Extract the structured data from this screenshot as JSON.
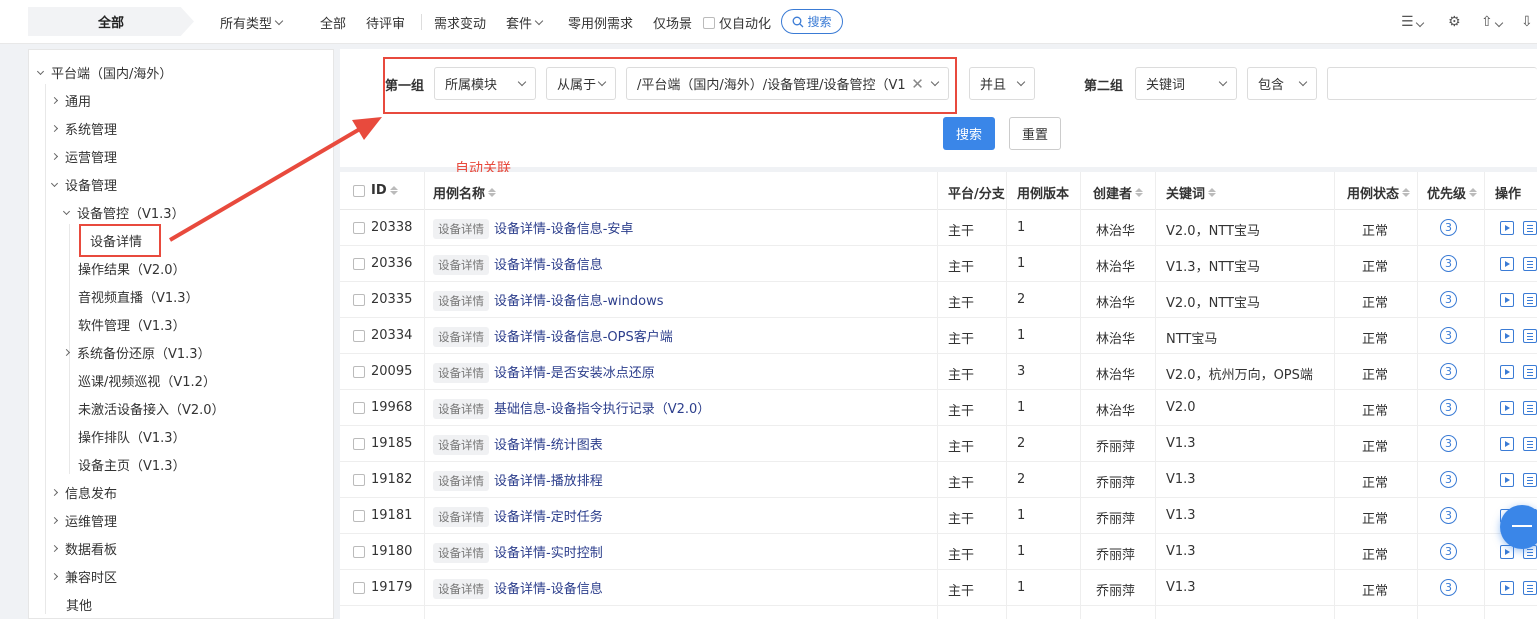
{
  "topbar": {
    "all_tab": "全部",
    "type_select": "所有类型",
    "items": [
      "全部",
      "待评审",
      "需求变动",
      "套件",
      "零用例需求",
      "仅场景"
    ],
    "auto_only_label": "仅自动化",
    "search_label": "搜索"
  },
  "tree": {
    "root": "平台端（国内/海外）",
    "nodes": [
      "通用",
      "系统管理",
      "运营管理",
      "设备管理",
      "设备管控（V1.3）",
      "设备详情",
      "操作结果（V2.0）",
      "音视频直播（V1.3）",
      "软件管理（V1.3）",
      "系统备份还原（V1.3）",
      "巡课/视频巡视（V1.2）",
      "未激活设备接入（V2.0）",
      "操作排队（V1.3）",
      "设备主页（V1.3）",
      "信息发布",
      "运维管理",
      "数据看板",
      "兼容时区",
      "其他"
    ]
  },
  "filter": {
    "group1_label": "第一组",
    "field1": "所属模块",
    "op1": "从属于",
    "value1": "/平台端（国内/海外）/设备管理/设备管控（V1",
    "logic": "并且",
    "group2_label": "第二组",
    "field2": "关键词",
    "op2": "包含",
    "search_button": "搜索",
    "reset_button": "重置",
    "annotation": "自动关联"
  },
  "table": {
    "headers": {
      "id": "ID",
      "name": "用例名称",
      "platform": "平台/分支",
      "version": "用例版本",
      "creator": "创建者",
      "keyword": "关键词",
      "status": "用例状态",
      "priority": "优先级",
      "action": "操作"
    },
    "tag": "设备详情",
    "rows": [
      {
        "id": "20338",
        "name": "设备详情-设备信息-安卓",
        "platform": "主干",
        "version": "1",
        "creator": "林治华",
        "keyword": "V2.0，NTT宝马",
        "status": "正常",
        "priority": "3"
      },
      {
        "id": "20336",
        "name": "设备详情-设备信息",
        "platform": "主干",
        "version": "1",
        "creator": "林治华",
        "keyword": "V1.3，NTT宝马",
        "status": "正常",
        "priority": "3"
      },
      {
        "id": "20335",
        "name": "设备详情-设备信息-windows",
        "platform": "主干",
        "version": "2",
        "creator": "林治华",
        "keyword": "V2.0，NTT宝马",
        "status": "正常",
        "priority": "3"
      },
      {
        "id": "20334",
        "name": "设备详情-设备信息-OPS客户端",
        "platform": "主干",
        "version": "1",
        "creator": "林治华",
        "keyword": "NTT宝马",
        "status": "正常",
        "priority": "3"
      },
      {
        "id": "20095",
        "name": "设备详情-是否安装冰点还原",
        "platform": "主干",
        "version": "3",
        "creator": "林治华",
        "keyword": "V2.0，杭州万向，OPS端",
        "status": "正常",
        "priority": "3"
      },
      {
        "id": "19968",
        "name": "基础信息-设备指令执行记录（V2.0）",
        "platform": "主干",
        "version": "1",
        "creator": "林治华",
        "keyword": "V2.0",
        "status": "正常",
        "priority": "3"
      },
      {
        "id": "19185",
        "name": "设备详情-统计图表",
        "platform": "主干",
        "version": "2",
        "creator": "乔丽萍",
        "keyword": "V1.3",
        "status": "正常",
        "priority": "3"
      },
      {
        "id": "19182",
        "name": "设备详情-播放排程",
        "platform": "主干",
        "version": "2",
        "creator": "乔丽萍",
        "keyword": "V1.3",
        "status": "正常",
        "priority": "3"
      },
      {
        "id": "19181",
        "name": "设备详情-定时任务",
        "platform": "主干",
        "version": "1",
        "creator": "乔丽萍",
        "keyword": "V1.3",
        "status": "正常",
        "priority": "3"
      },
      {
        "id": "19180",
        "name": "设备详情-实时控制",
        "platform": "主干",
        "version": "1",
        "creator": "乔丽萍",
        "keyword": "V1.3",
        "status": "正常",
        "priority": "3"
      },
      {
        "id": "19179",
        "name": "设备详情-设备信息",
        "platform": "主干",
        "version": "1",
        "creator": "乔丽萍",
        "keyword": "V1.3",
        "status": "正常",
        "priority": "3"
      }
    ]
  },
  "colors": {
    "accent": "#3a86e8",
    "annotation_red": "#e84a3d",
    "link": "#2c3e8c"
  }
}
